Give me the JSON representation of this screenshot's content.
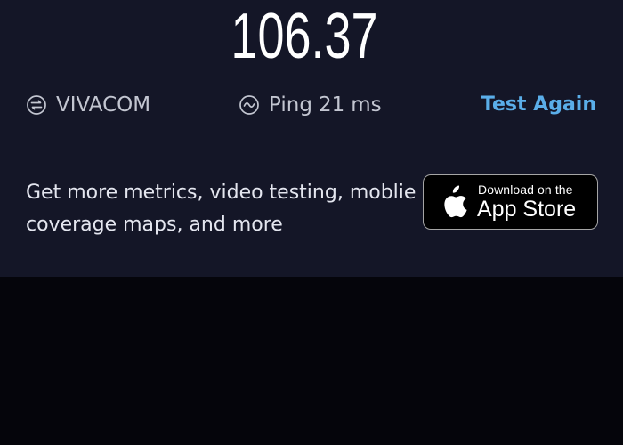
{
  "result": {
    "speed_value": "106.37"
  },
  "provider": {
    "name": "VIVACOM",
    "icon": "provider-exchange-icon"
  },
  "ping": {
    "label": "Ping",
    "value": "21",
    "unit": "ms",
    "icon": "ping-wave-icon"
  },
  "actions": {
    "test_again": "Test Again"
  },
  "promo": {
    "line_1": "Get more metrics, video testing, moblie",
    "line_2": "coverage maps, and more"
  },
  "app_store": {
    "small_text": "Download on the",
    "large_text": "App Store",
    "icon": "apple-logo-icon"
  },
  "colors": {
    "top_background": "#141627",
    "bottom_background": "#05050b",
    "accent": "#5aaee9",
    "text": "#c3c6d1"
  }
}
